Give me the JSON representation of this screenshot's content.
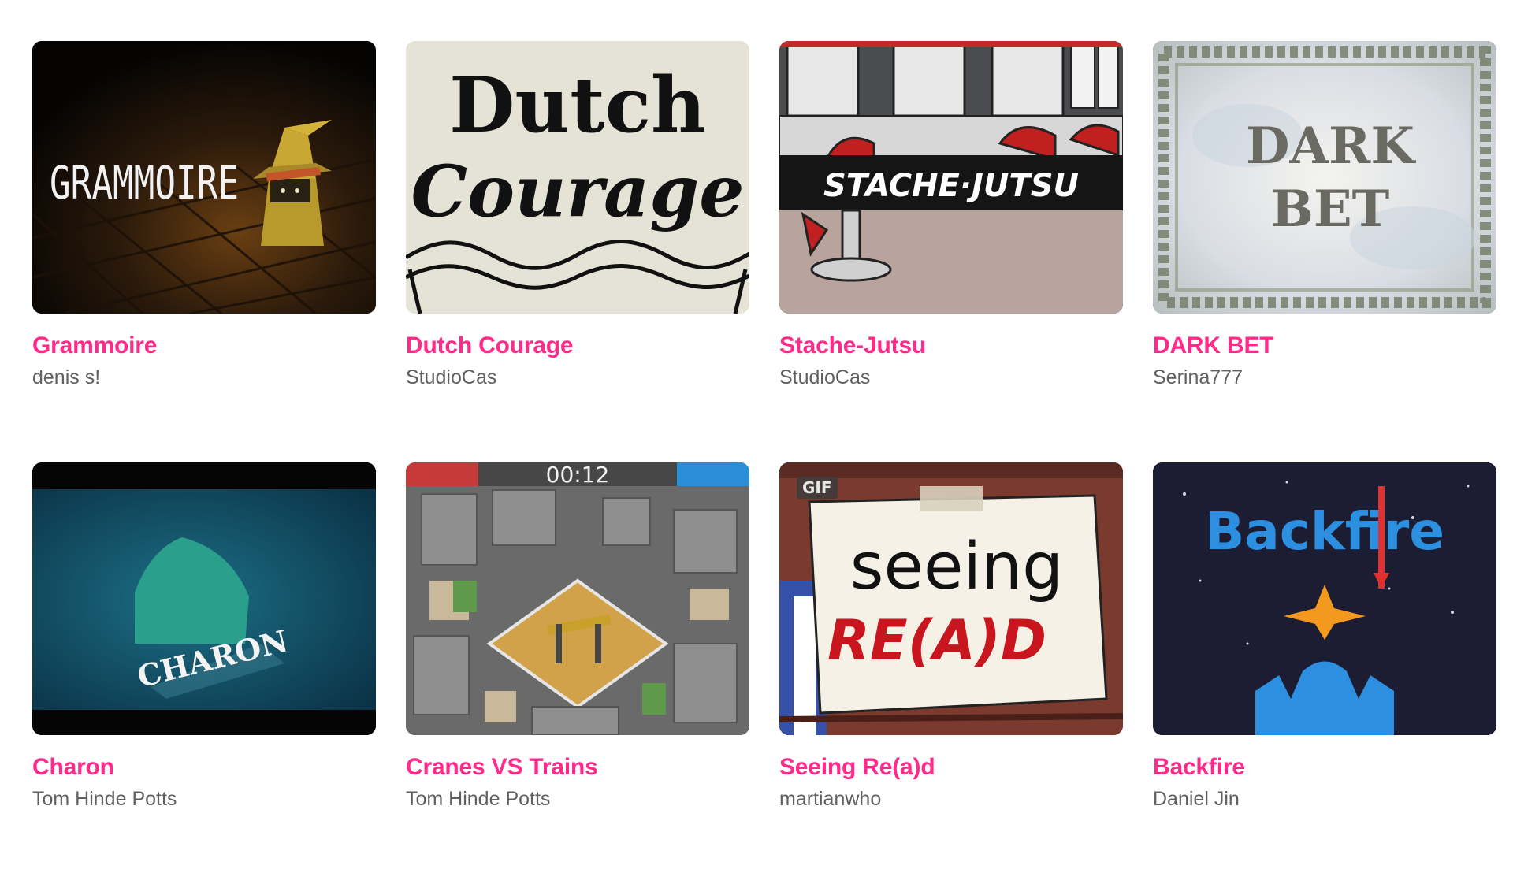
{
  "games": [
    {
      "title": "Grammoire",
      "author": "denis s!",
      "art_text": "GRAMMOIRE"
    },
    {
      "title": "Dutch Courage",
      "author": "StudioCas",
      "art_text": "Dutch",
      "art_text2": "Courage"
    },
    {
      "title": "Stache-Jutsu",
      "author": "StudioCas",
      "art_text": "STACHE·JUTSU"
    },
    {
      "title": "DARK BET",
      "author": "Serina777",
      "art_text": "DARK",
      "art_text2": "BET"
    },
    {
      "title": "Charon",
      "author": "Tom Hinde Potts",
      "art_text": "CHARON"
    },
    {
      "title": "Cranes VS Trains",
      "author": "Tom Hinde Potts",
      "timer": "00:12"
    },
    {
      "title": "Seeing Re(a)d",
      "author": "martianwho",
      "badge": "GIF",
      "art_text": "seeing",
      "art_text2": "RE(A)D"
    },
    {
      "title": "Backfire",
      "author": "Daniel Jin",
      "art_text": "Backfire"
    }
  ],
  "colors": {
    "title": "#ff2a89",
    "author": "#606060"
  }
}
